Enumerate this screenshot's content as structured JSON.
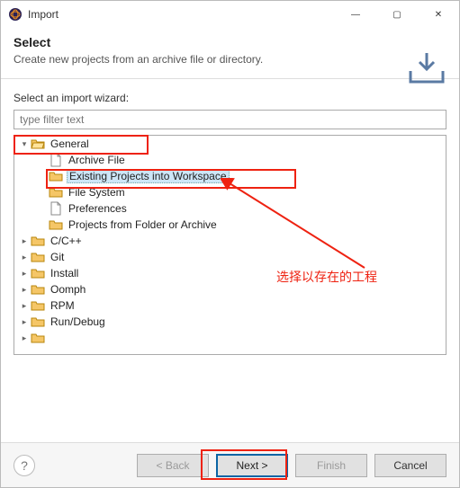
{
  "window": {
    "title": "Import",
    "minimize": "—",
    "maximize": "▢",
    "close": "✕"
  },
  "header": {
    "title": "Select",
    "description": "Create new projects from an archive file or directory."
  },
  "content": {
    "prompt": "Select an import wizard:",
    "filter_placeholder": "type filter text"
  },
  "tree": {
    "general": {
      "label": "General",
      "children": {
        "archive_file": "Archive File",
        "existing_projects": "Existing Projects into Workspace",
        "file_system": "File System",
        "preferences": "Preferences",
        "projects_from_folder": "Projects from Folder or Archive"
      }
    },
    "ccpp": "C/C++",
    "git": "Git",
    "install": "Install",
    "oomph": "Oomph",
    "rpm": "RPM",
    "rundebug": "Run/Debug"
  },
  "annotation": {
    "text": "选择以存在的工程"
  },
  "footer": {
    "back": "< Back",
    "next": "Next >",
    "finish": "Finish",
    "cancel": "Cancel"
  },
  "icons": {
    "app": "eclipse-icon",
    "import": "import-icon",
    "folder_open": "folder-open-icon",
    "folder": "folder-icon",
    "file": "file-icon",
    "chevron_down": "▾",
    "chevron_right": "▸"
  }
}
